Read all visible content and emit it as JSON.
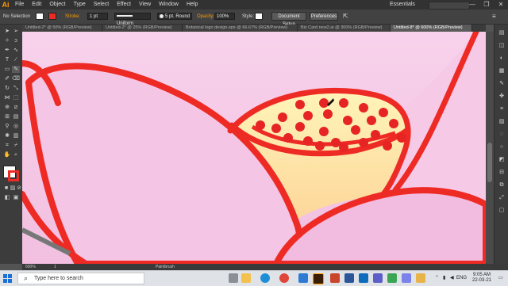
{
  "app": {
    "logo": "Ai",
    "menus": [
      "File",
      "Edit",
      "Object",
      "Type",
      "Select",
      "Effect",
      "View",
      "Window",
      "Help"
    ],
    "workspace": "Essentials",
    "window_controls": [
      "—",
      "❐",
      "✕"
    ]
  },
  "control_bar": {
    "selection": "No Selection",
    "stroke_label": "Stroke:",
    "stroke_weight": "1 pt",
    "profile": "Uniform",
    "brush": "5 pt. Round",
    "opacity_label": "Opacity:",
    "opacity_value": "100%",
    "style_label": "Style:",
    "document_setup": "Document Setup",
    "preferences": "Preferences",
    "accent": "#ff9a00"
  },
  "tabs": [
    {
      "label": "Untitled-2* @ 50% (RGB/Preview)",
      "active": false
    },
    {
      "label": "Untitled-2* @ 25% (RGB/Preview)",
      "active": false
    },
    {
      "label": "Botanical logo design.eps @ 66.67% (RGB/Preview)",
      "active": false
    },
    {
      "label": "Biz Card new2.ai @ 300% (RGB/Preview)",
      "active": false
    },
    {
      "label": "Untitled-8* @ 600% (RGB/Preview)",
      "active": true
    }
  ],
  "status_bar": {
    "zoom": "600%",
    "page": "1",
    "tool": "Paintbrush"
  },
  "artwork": {
    "stroke_color": "#ee2a24",
    "petal_color": "#f4c5e4",
    "center_color": "#fde0a3",
    "seed_color": "#e62424"
  },
  "taskbar": {
    "search_placeholder": "Type here to search",
    "apps": [
      "task-view",
      "file-explorer",
      "edge",
      "chrome",
      "photos",
      "illustrator",
      "powerpoint",
      "word",
      "mail",
      "store",
      "maps",
      "teams",
      "folder"
    ],
    "tray": {
      "lang": "ENG",
      "time": "9:05 AM",
      "date": "22-03-21"
    }
  }
}
